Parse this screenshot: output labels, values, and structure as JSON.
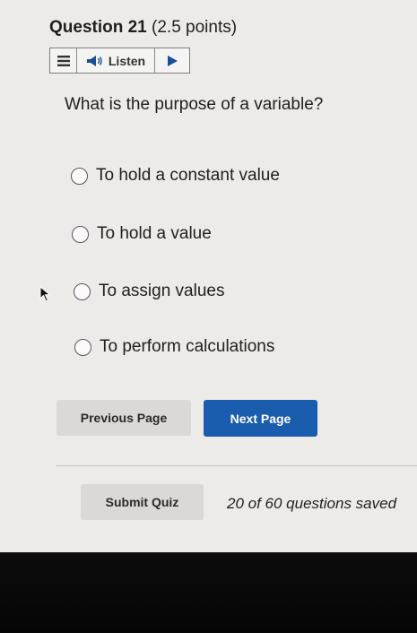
{
  "question": {
    "number_label": "Question 21",
    "points_label": "(2.5 points)",
    "prompt": "What is the purpose of a variable?"
  },
  "listen_bar": {
    "menu_icon": "hamburger-menu-icon",
    "speaker_icon": "speaker-icon",
    "listen_label": "Listen",
    "play_icon": "play-icon"
  },
  "options": [
    {
      "label": "To hold a constant value",
      "selected": false
    },
    {
      "label": "To hold a value",
      "selected": false
    },
    {
      "label": "To assign values",
      "selected": false
    },
    {
      "label": "To perform calculations",
      "selected": false
    }
  ],
  "navigation": {
    "previous_label": "Previous Page",
    "next_label": "Next Page"
  },
  "footer": {
    "submit_label": "Submit Quiz",
    "saved_status": "20 of 60 questions saved"
  },
  "colors": {
    "primary_button": "#1a5cad",
    "background": "#ecebe7"
  }
}
